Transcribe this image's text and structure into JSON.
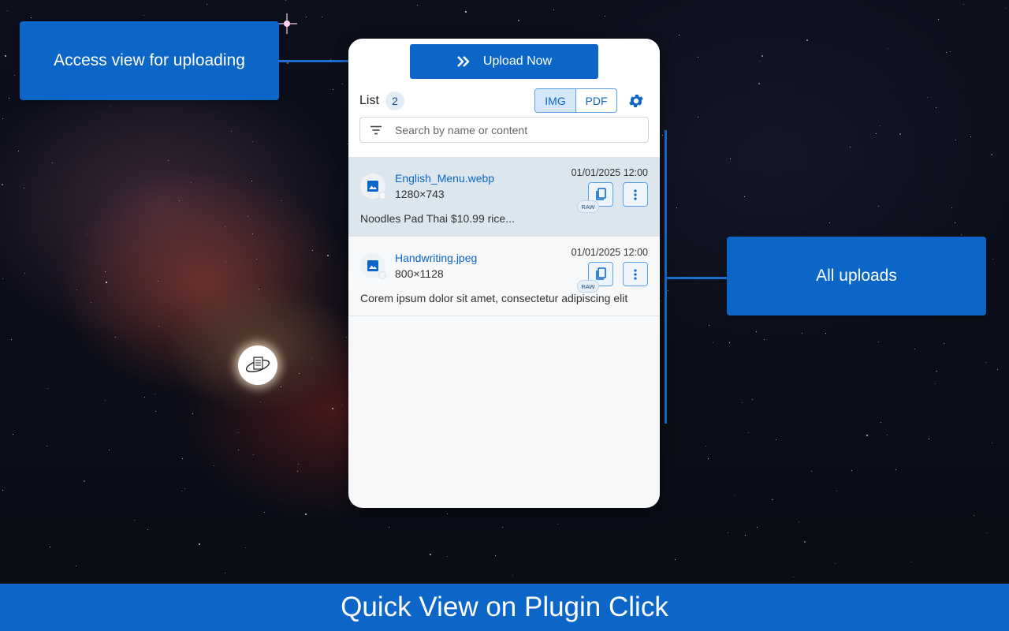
{
  "callouts": {
    "upload_access": "Access view for uploading",
    "all_uploads": "All uploads"
  },
  "panel": {
    "upload_button": "Upload Now",
    "list_label": "List",
    "list_count": "2",
    "filter_options": [
      "IMG",
      "PDF"
    ],
    "active_filter": "IMG",
    "search_placeholder": "Search by name or content",
    "items": [
      {
        "name": "English_Menu.webp",
        "dimensions": "1280×743",
        "date": "01/01/2025 12:00",
        "badge": "RAW",
        "content": "Noodles Pad Thai $10.99 rice...",
        "selected": true
      },
      {
        "name": "Handwriting.jpeg",
        "dimensions": "800×1128",
        "date": "01/01/2025 12:00",
        "badge": "RAW",
        "content": "Corem ipsum dolor sit amet, consectetur adipiscing elit",
        "selected": false
      }
    ]
  },
  "footer": {
    "title": "Quick View on Plugin Click"
  },
  "icons": {
    "upload": "double-chevron-right-icon",
    "settings": "gear-icon",
    "filter": "filter-icon",
    "file": "image-icon",
    "copy": "copy-icon",
    "more": "more-vertical-icon",
    "plugin": "plugin-orb-icon"
  },
  "colors": {
    "accent": "#0b66c8",
    "selected_row": "#dbe6ee",
    "panel_bg": "#f7f8fa"
  }
}
